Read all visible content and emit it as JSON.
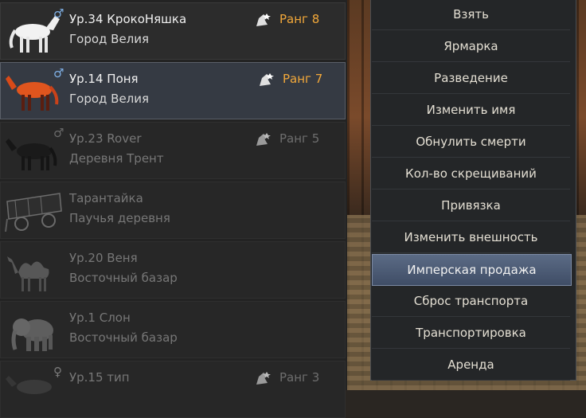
{
  "mounts": [
    {
      "name": "Ур.34 КрокоНяшка",
      "location": "Город Велия",
      "gender": "♂",
      "rank": "Ранг 8",
      "icon": "white-horse-icon",
      "state": "normal"
    },
    {
      "name": "Ур.14 Поня",
      "location": "Город Велия",
      "gender": "♂",
      "rank": "Ранг 7",
      "icon": "orange-horse-icon",
      "state": "selected"
    },
    {
      "name": "Ур.23 Rover",
      "location": "Деревня Трент",
      "gender": "♂",
      "rank": "Ранг 5",
      "icon": "black-horse-icon",
      "state": "dim"
    },
    {
      "name": "Тарантайка",
      "location": "Паучья деревня",
      "gender": "",
      "rank": "",
      "icon": "wagon-icon",
      "state": "dim"
    },
    {
      "name": "Ур.20 Веня",
      "location": "Восточный базар",
      "gender": "",
      "rank": "",
      "icon": "camel-icon",
      "state": "dim"
    },
    {
      "name": "Ур.1 Слон",
      "location": "Восточный базар",
      "gender": "",
      "rank": "",
      "icon": "elephant-icon",
      "state": "dim"
    },
    {
      "name": "Ур.15 тип",
      "location": "",
      "gender": "♀",
      "rank": "Ранг 3",
      "icon": "grey-horse-icon",
      "state": "dim"
    }
  ],
  "context_menu": {
    "items": [
      "Взять",
      "Ярмарка",
      "Разведение",
      "Изменить имя",
      "Обнулить смерти",
      "Кол-во скрещиваний",
      "Привязка",
      "Изменить внешность",
      "Имперская продажа",
      "Сброс транспорта",
      "Транспортировка",
      "Аренда"
    ],
    "highlighted": "Имперская продажа"
  },
  "colors": {
    "rank_text": "#f2a83a",
    "male_symbol": "#7fb0e6",
    "menu_highlight": "#4b5a75"
  }
}
